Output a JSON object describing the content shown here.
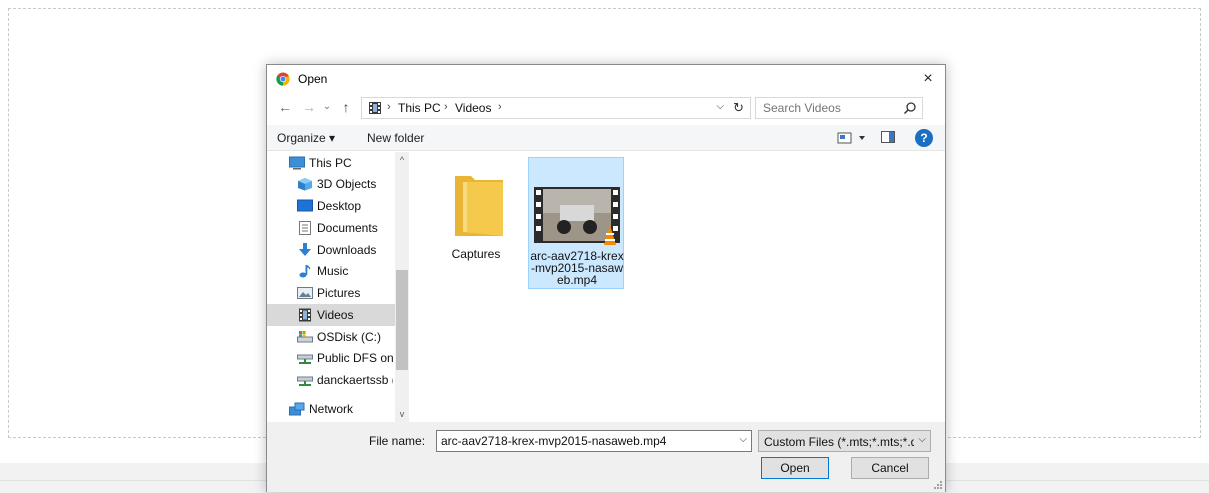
{
  "dialog": {
    "title": "Open",
    "close_glyph": "×"
  },
  "nav": {
    "back_glyph": "←",
    "forward_glyph": "→",
    "recent_glyph": "⌄",
    "up_glyph": "↑"
  },
  "address": {
    "crumbs": [
      "This PC",
      "Videos"
    ],
    "separator": "›",
    "dropdown_glyph": "⌵",
    "refresh_glyph": "↻"
  },
  "search": {
    "placeholder": "Search Videos"
  },
  "toolbar": {
    "organize_label": "Organize ▾",
    "new_folder_label": "New folder",
    "help_label": "?"
  },
  "sidebar": {
    "items": [
      {
        "label": "This PC",
        "icon": "computer-icon"
      },
      {
        "label": "3D Objects",
        "icon": "3d-objects-icon"
      },
      {
        "label": "Desktop",
        "icon": "desktop-icon"
      },
      {
        "label": "Documents",
        "icon": "documents-icon"
      },
      {
        "label": "Downloads",
        "icon": "downloads-icon"
      },
      {
        "label": "Music",
        "icon": "music-icon"
      },
      {
        "label": "Pictures",
        "icon": "pictures-icon"
      },
      {
        "label": "Videos",
        "icon": "videos-icon",
        "selected": true
      },
      {
        "label": "OSDisk (C:)",
        "icon": "drive-icon"
      },
      {
        "label": "Public DFS on N",
        "icon": "network-drive-icon"
      },
      {
        "label": "danckaertssb (\\\\",
        "icon": "network-drive-icon"
      },
      {
        "label": "Network",
        "icon": "network-icon"
      }
    ]
  },
  "scrollbar": {
    "up_glyph": "^",
    "down_glyph": "v"
  },
  "files": [
    {
      "name_lines": [
        "Captures"
      ],
      "type": "folder"
    },
    {
      "name_lines": [
        "arc-aav2718-krex",
        "-mvp2015-nasaw",
        "eb.mp4"
      ],
      "type": "video",
      "selected": true
    }
  ],
  "bottom": {
    "file_name_label": "File name:",
    "file_name_value": "arc-aav2718-krex-mvp2015-nasaweb.mp4",
    "file_type_value": "Custom Files (*.mts;*.mts;*.qt;*",
    "dropdown_glyph": "⌵",
    "open_label": "Open",
    "cancel_label": "Cancel"
  },
  "colors": {
    "accent": "#0078d7",
    "selection_bg": "#cce8ff",
    "selection_border": "#99d1ff",
    "help_blue": "#1a6fc4",
    "folder_yellow": "#f5c94c"
  }
}
